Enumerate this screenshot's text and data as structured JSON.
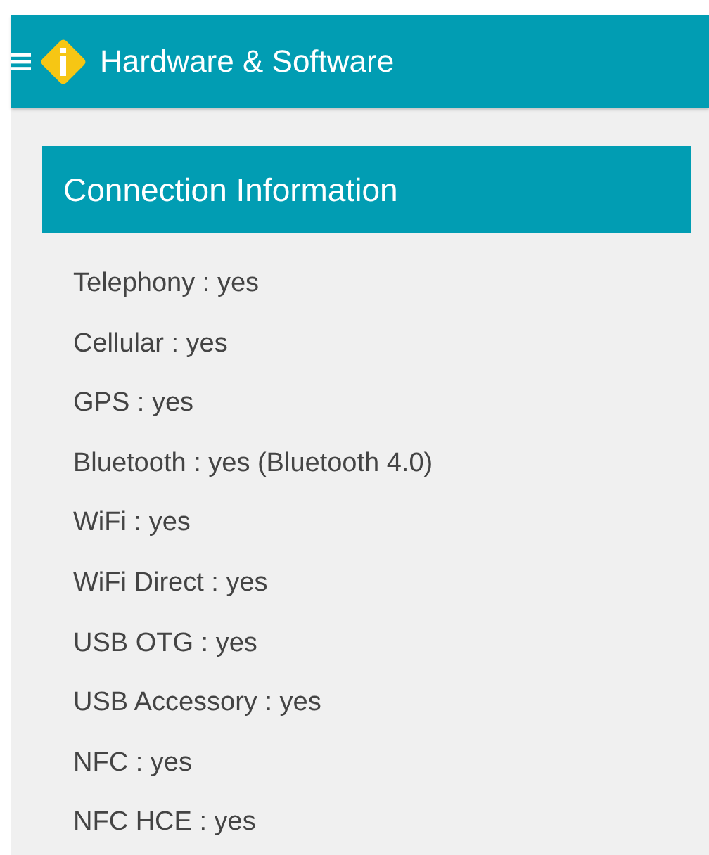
{
  "app_bar": {
    "title": "Hardware & Software"
  },
  "section": {
    "title": "Connection Information"
  },
  "items": [
    {
      "text": "Telephony : yes"
    },
    {
      "text": "Cellular : yes"
    },
    {
      "text": "GPS : yes"
    },
    {
      "text": "Bluetooth : yes (Bluetooth 4.0)"
    },
    {
      "text": "WiFi : yes"
    },
    {
      "text": "WiFi Direct : yes"
    },
    {
      "text": "USB OTG : yes"
    },
    {
      "text": "USB Accessory : yes"
    },
    {
      "text": "NFC : yes"
    },
    {
      "text": "NFC HCE : yes"
    }
  ]
}
